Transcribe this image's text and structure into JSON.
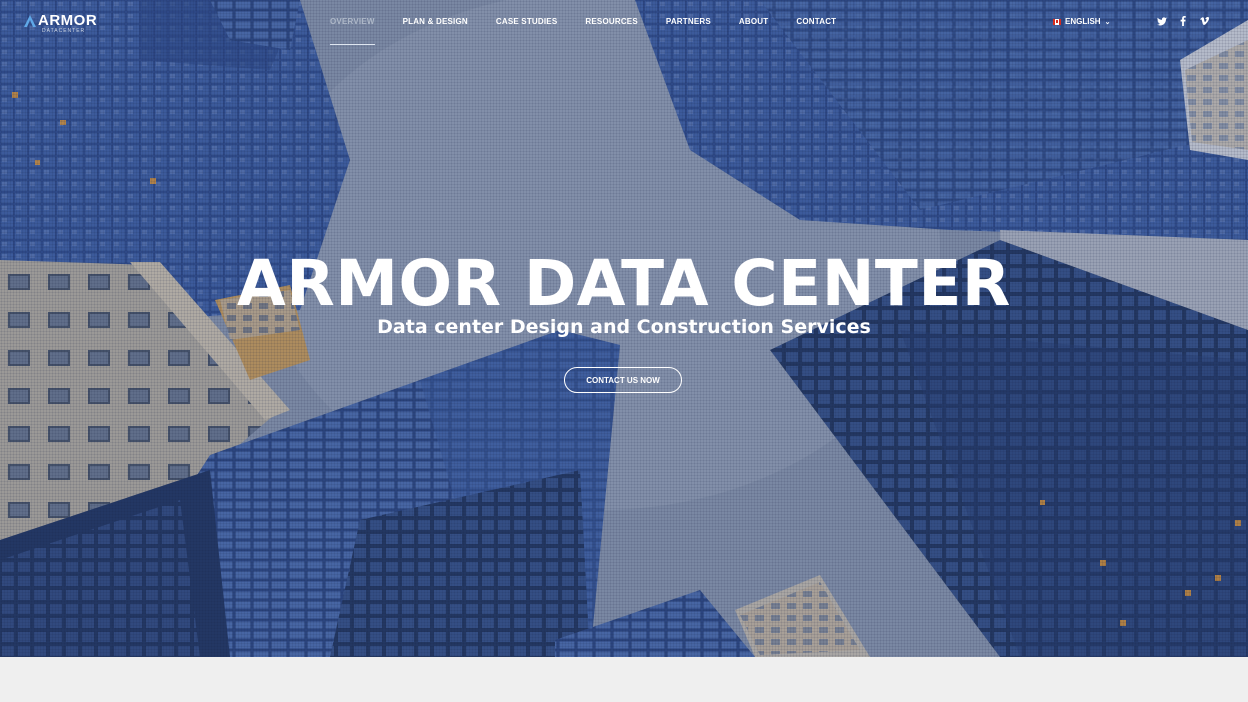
{
  "brand": {
    "name": "ARMOR",
    "tagline": "DATACENTER"
  },
  "nav": {
    "items": [
      {
        "label": "OVERVIEW",
        "active": true
      },
      {
        "label": "PLAN & DESIGN",
        "active": false
      },
      {
        "label": "CASE STUDIES",
        "active": false
      },
      {
        "label": "RESOURCES",
        "active": false
      },
      {
        "label": "PARTNERS",
        "active": false
      },
      {
        "label": "ABOUT",
        "active": false
      },
      {
        "label": "CONTACT",
        "active": false
      }
    ]
  },
  "language": {
    "selected": "ENGLISH",
    "flag": "canada-flag-icon"
  },
  "social": [
    "twitter-icon",
    "facebook-icon",
    "vimeo-icon"
  ],
  "hero": {
    "title": "ARMOR DATA CENTER",
    "subtitle": "Data center Design and Construction Services",
    "cta_label": "CONTACT US NOW"
  },
  "colors": {
    "text": "#ffffff",
    "active_nav": "#aeb8c8",
    "sky": "#8d9bb1",
    "glass": "#2e4f96",
    "footer": "#efefef"
  }
}
